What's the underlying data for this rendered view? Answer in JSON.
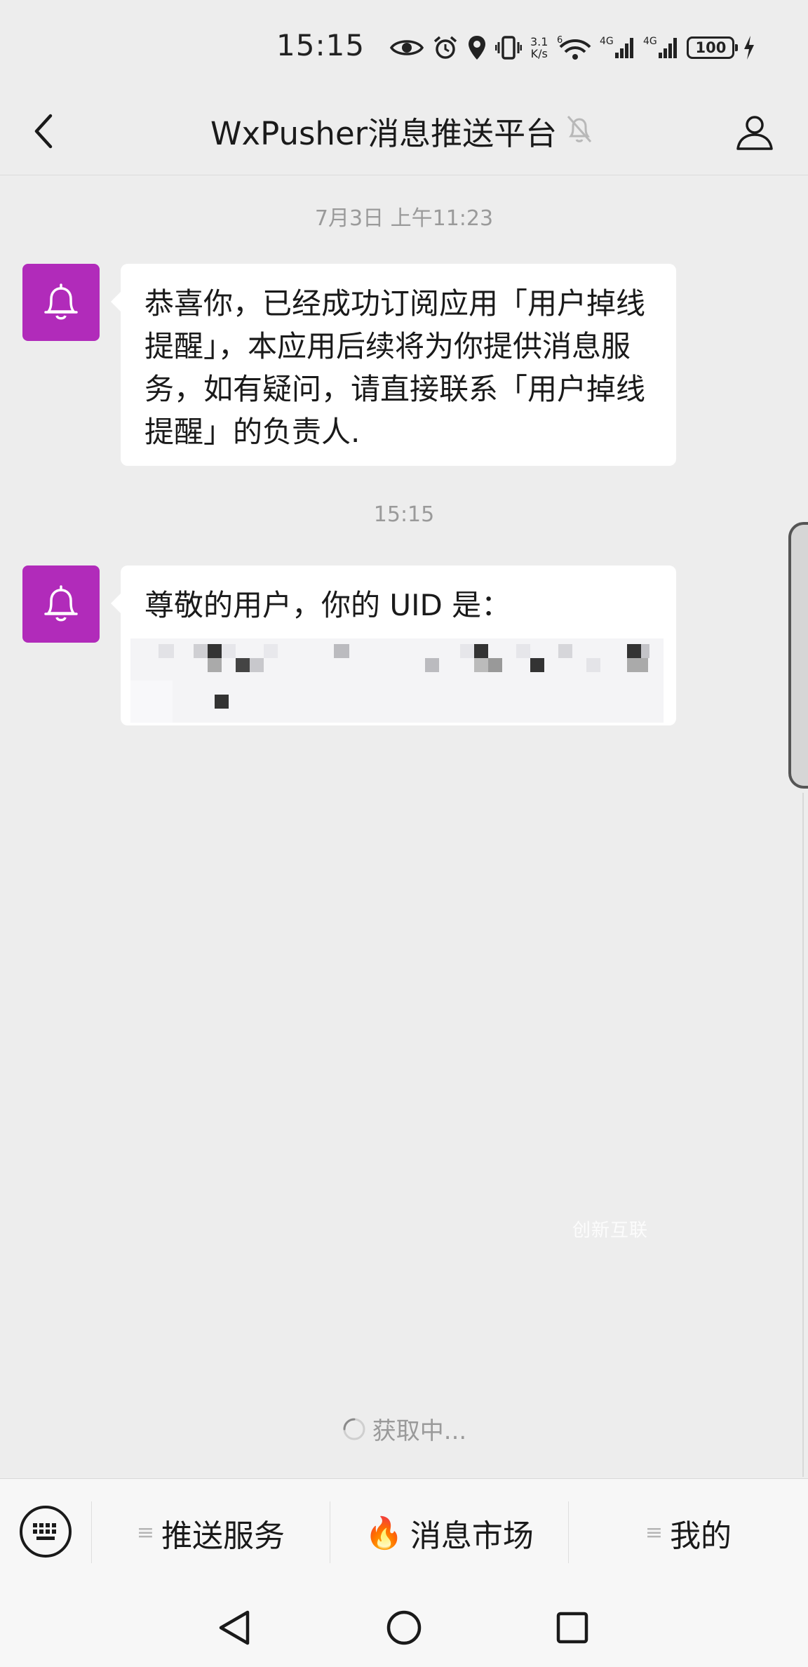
{
  "status_bar": {
    "time": "15:15",
    "net_speed_value": "3.1",
    "net_speed_unit": "K/s",
    "wifi_label": "6",
    "sim1_label": "4G",
    "sim2_label": "4G",
    "battery_level": "100"
  },
  "header": {
    "title": "WxPusher消息推送平台"
  },
  "messages": [
    {
      "timestamp": "7月3日 上午11:23",
      "text": "恭喜你，已经成功订阅应用「用户掉线提醒」，本应用后续将为你提供消息服务，如有疑问，请直接联系「用户掉线提醒」的负责人."
    },
    {
      "timestamp": "15:15",
      "text": "尊敬的用户，你的 UID 是："
    }
  ],
  "loading": {
    "text": "获取中..."
  },
  "watermark": {
    "text": "创新互联"
  },
  "menu": {
    "items": [
      {
        "label": "推送服务",
        "prefix": "≡"
      },
      {
        "label": "消息市场",
        "prefix": "🔥"
      },
      {
        "label": "我的",
        "prefix": "≡"
      }
    ]
  },
  "colors": {
    "avatar_bg": "#b12bba",
    "chat_bg": "#ededed",
    "bubble_bg": "#ffffff"
  }
}
